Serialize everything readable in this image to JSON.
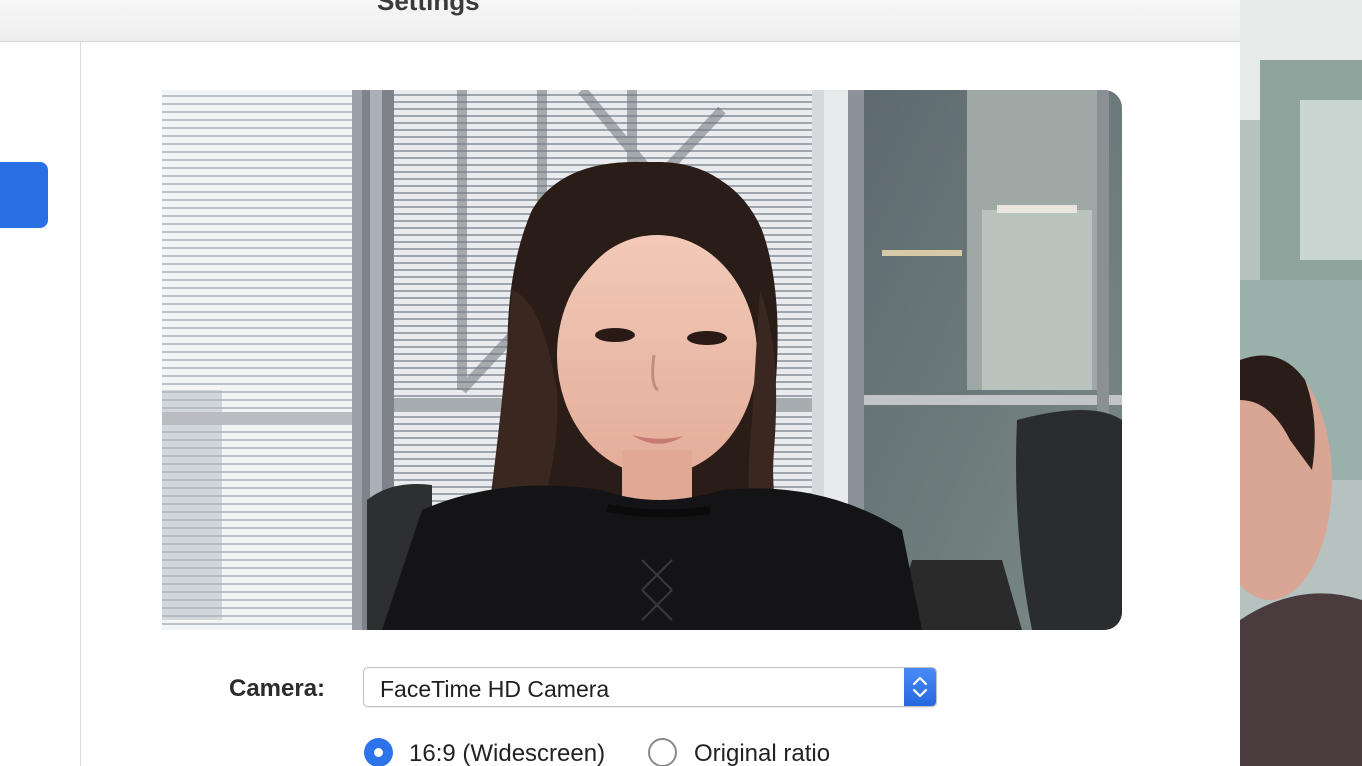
{
  "window": {
    "title": "Settings"
  },
  "sidebar": {
    "selected_item_icon": "video-camera-icon"
  },
  "video": {
    "camera_label": "Camera:",
    "camera_selected": "FaceTime HD Camera",
    "aspect_options": [
      {
        "label": "16:9 (Widescreen)",
        "selected": true
      },
      {
        "label": "Original ratio",
        "selected": false
      }
    ]
  },
  "colors": {
    "accent": "#2a6fe3",
    "radio_selected": "#2d73ea"
  }
}
